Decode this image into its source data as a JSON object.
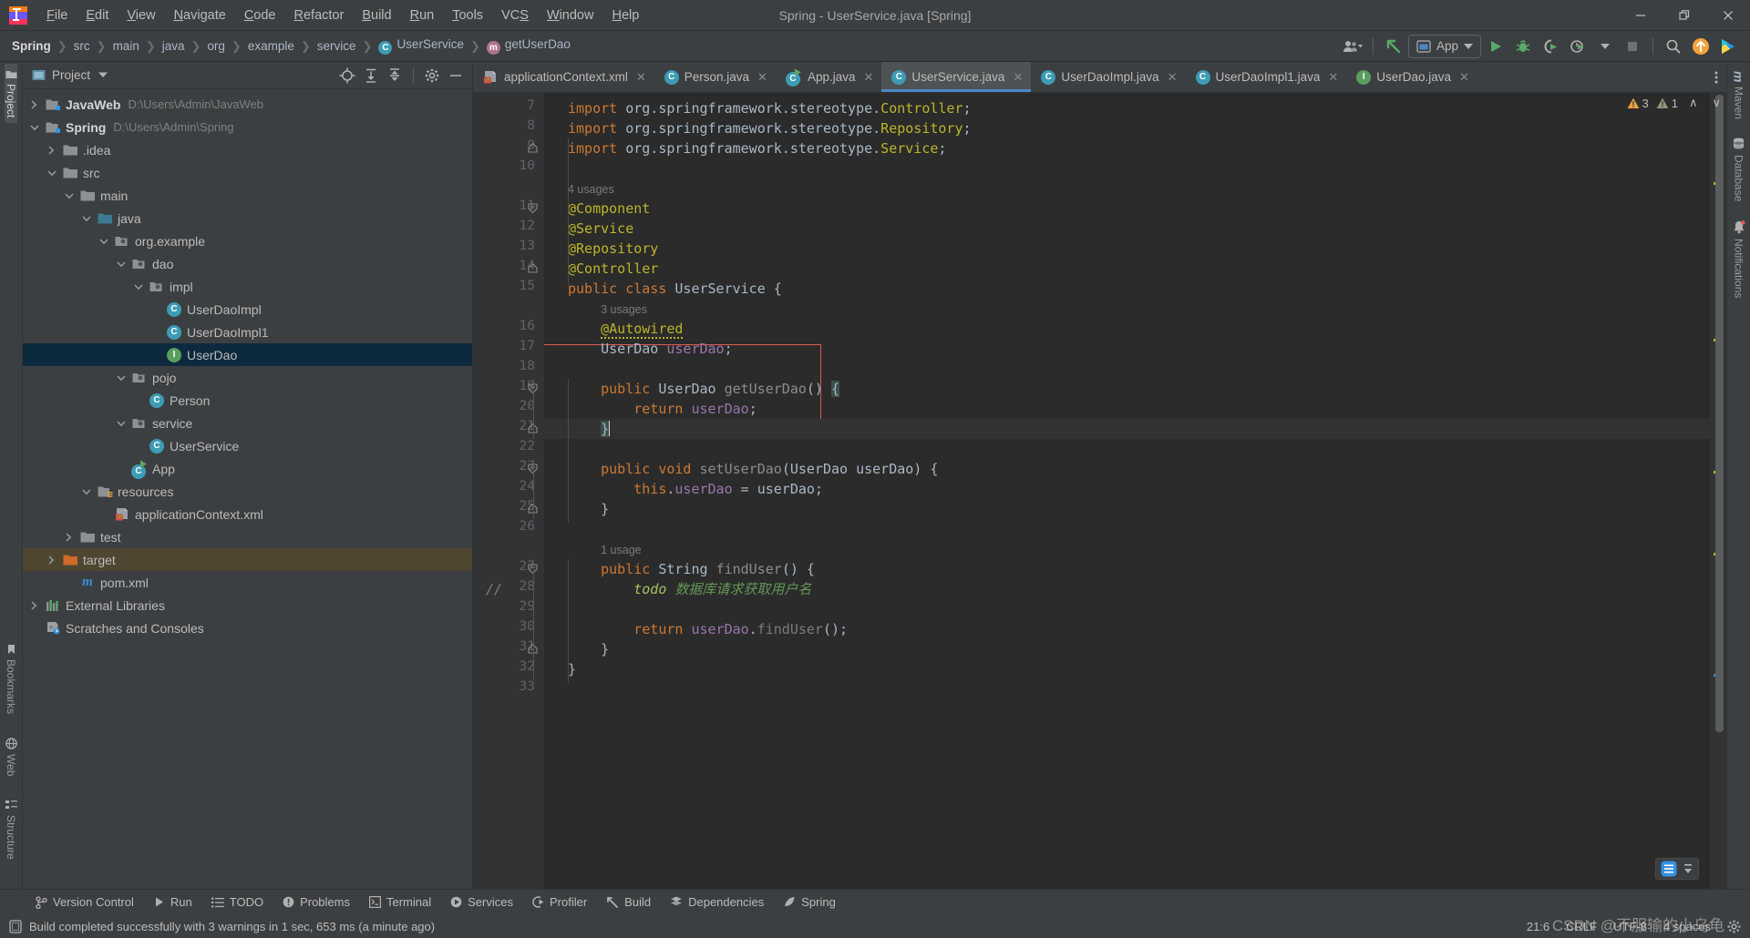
{
  "window": {
    "title": "Spring - UserService.java [Spring]",
    "minimize_label": "—",
    "maximize_label": "❐",
    "close_label": "✕"
  },
  "menubar": {
    "items": [
      {
        "label": "File"
      },
      {
        "label": "Edit"
      },
      {
        "label": "View"
      },
      {
        "label": "Navigate"
      },
      {
        "label": "Code"
      },
      {
        "label": "Refactor"
      },
      {
        "label": "Build"
      },
      {
        "label": "Run"
      },
      {
        "label": "Tools"
      },
      {
        "label": "VCS"
      },
      {
        "label": "Window"
      },
      {
        "label": "Help"
      }
    ]
  },
  "breadcrumbs": [
    {
      "label": "Spring",
      "icon": ""
    },
    {
      "label": "src",
      "icon": ""
    },
    {
      "label": "main",
      "icon": ""
    },
    {
      "label": "java",
      "icon": ""
    },
    {
      "label": "org",
      "icon": ""
    },
    {
      "label": "example",
      "icon": ""
    },
    {
      "label": "service",
      "icon": ""
    },
    {
      "label": "UserService",
      "icon": "class-icon"
    },
    {
      "label": "getUserDao",
      "icon": "method-icon"
    }
  ],
  "toolbar": {
    "run_config": "App",
    "run_config_icon": "app-window-icon",
    "buttons": [
      {
        "name": "profile-dropdown",
        "icon": "user-icon"
      },
      {
        "name": "update-project",
        "icon": "arrow-up-left-icon"
      },
      {
        "name": "run-button",
        "icon": "play-icon"
      },
      {
        "name": "debug-button",
        "icon": "bug-icon"
      },
      {
        "name": "run-with-coverage",
        "icon": "coverage-icon"
      },
      {
        "name": "profiler-button",
        "icon": "clock-play-icon"
      },
      {
        "name": "stop-button",
        "icon": "stop-square-icon"
      },
      {
        "name": "search-everywhere",
        "icon": "search-icon"
      },
      {
        "name": "updates-available",
        "icon": "orange-arrow-icon"
      },
      {
        "name": "ide-assistant",
        "icon": "colorful-icon"
      }
    ]
  },
  "left_strip": {
    "top": [
      {
        "label": "Project",
        "icon": "project-folder-icon",
        "active": true
      }
    ],
    "bottom": [
      {
        "label": "Bookmarks",
        "icon": "bookmark-icon"
      },
      {
        "label": "Web",
        "icon": "web-icon"
      },
      {
        "label": "Structure",
        "icon": "structure-icon"
      }
    ]
  },
  "right_strip": [
    {
      "label": "Maven",
      "icon": "maven-icon"
    },
    {
      "label": "Database",
      "icon": "database-icon"
    },
    {
      "label": "Notifications",
      "icon": "bell-icon",
      "badge": true
    }
  ],
  "project_panel": {
    "title": "Project",
    "actions": [
      {
        "name": "select-opened-file",
        "icon": "target-icon"
      },
      {
        "name": "expand-all",
        "icon": "expand-all-icon"
      },
      {
        "name": "collapse-all",
        "icon": "collapse-all-icon"
      },
      {
        "name": "panel-settings",
        "icon": "gear-icon"
      },
      {
        "name": "hide-panel",
        "icon": "minus-icon"
      }
    ],
    "tree": [
      {
        "label": "JavaWeb",
        "path": "D:\\Users\\Admin\\JavaWeb",
        "depth": 0,
        "twist": "collapsed",
        "icon": "module-folder-icon",
        "bold": true,
        "state": "normal"
      },
      {
        "label": "Spring",
        "path": "D:\\Users\\Admin\\Spring",
        "depth": 0,
        "twist": "expanded",
        "icon": "module-folder-icon",
        "bold": true,
        "state": "normal"
      },
      {
        "label": ".idea",
        "path": "",
        "depth": 1,
        "twist": "collapsed",
        "icon": "folder-icon",
        "bold": false,
        "state": "normal"
      },
      {
        "label": "src",
        "path": "",
        "depth": 1,
        "twist": "expanded",
        "icon": "folder-icon",
        "bold": false,
        "state": "normal"
      },
      {
        "label": "main",
        "path": "",
        "depth": 2,
        "twist": "expanded",
        "icon": "folder-icon",
        "bold": false,
        "state": "normal"
      },
      {
        "label": "java",
        "path": "",
        "depth": 3,
        "twist": "expanded",
        "icon": "source-folder-icon",
        "bold": false,
        "state": "normal"
      },
      {
        "label": "org.example",
        "path": "",
        "depth": 4,
        "twist": "expanded",
        "icon": "package-icon",
        "bold": false,
        "state": "normal"
      },
      {
        "label": "dao",
        "path": "",
        "depth": 5,
        "twist": "expanded",
        "icon": "package-icon",
        "bold": false,
        "state": "normal"
      },
      {
        "label": "impl",
        "path": "",
        "depth": 6,
        "twist": "expanded",
        "icon": "package-icon",
        "bold": false,
        "state": "normal"
      },
      {
        "label": "UserDaoImpl",
        "path": "",
        "depth": 7,
        "twist": "none",
        "icon": "class-icon",
        "bold": false,
        "state": "normal"
      },
      {
        "label": "UserDaoImpl1",
        "path": "",
        "depth": 7,
        "twist": "none",
        "icon": "class-icon",
        "bold": false,
        "state": "normal"
      },
      {
        "label": "UserDao",
        "path": "",
        "depth": 7,
        "twist": "none",
        "icon": "interface-icon",
        "bold": false,
        "state": "selected"
      },
      {
        "label": "pojo",
        "path": "",
        "depth": 5,
        "twist": "expanded",
        "icon": "package-icon",
        "bold": false,
        "state": "normal"
      },
      {
        "label": "Person",
        "path": "",
        "depth": 6,
        "twist": "none",
        "icon": "class-icon",
        "bold": false,
        "state": "normal"
      },
      {
        "label": "service",
        "path": "",
        "depth": 5,
        "twist": "expanded",
        "icon": "package-icon",
        "bold": false,
        "state": "normal"
      },
      {
        "label": "UserService",
        "path": "",
        "depth": 6,
        "twist": "none",
        "icon": "class-icon",
        "bold": false,
        "state": "normal"
      },
      {
        "label": "App",
        "path": "",
        "depth": 5,
        "twist": "none",
        "icon": "runnable-class-icon",
        "bold": false,
        "state": "normal"
      },
      {
        "label": "resources",
        "path": "",
        "depth": 3,
        "twist": "expanded",
        "icon": "resources-folder-icon",
        "bold": false,
        "state": "normal"
      },
      {
        "label": "applicationContext.xml",
        "path": "",
        "depth": 4,
        "twist": "none",
        "icon": "spring-xml-icon",
        "bold": false,
        "state": "normal"
      },
      {
        "label": "test",
        "path": "",
        "depth": 2,
        "twist": "collapsed",
        "icon": "folder-icon",
        "bold": false,
        "state": "normal"
      },
      {
        "label": "target",
        "path": "",
        "depth": 1,
        "twist": "collapsed",
        "icon": "target-folder-icon",
        "bold": false,
        "state": "highlight"
      },
      {
        "label": "pom.xml",
        "path": "",
        "depth": 2,
        "twist": "none",
        "icon": "maven-file-icon",
        "bold": false,
        "state": "normal"
      },
      {
        "label": "External Libraries",
        "path": "",
        "depth": 0,
        "twist": "collapsed",
        "icon": "libraries-icon",
        "bold": false,
        "state": "normal"
      },
      {
        "label": "Scratches and Consoles",
        "path": "",
        "depth": 0,
        "twist": "none",
        "icon": "scratches-icon",
        "bold": false,
        "state": "normal"
      }
    ]
  },
  "editor_tabs": [
    {
      "label": "applicationContext.xml",
      "icon": "spring-xml-icon",
      "active": false
    },
    {
      "label": "Person.java",
      "icon": "class-icon",
      "active": false
    },
    {
      "label": "App.java",
      "icon": "runnable-class-icon",
      "active": false
    },
    {
      "label": "UserService.java",
      "icon": "class-icon",
      "active": true
    },
    {
      "label": "UserDaoImpl.java",
      "icon": "class-icon",
      "active": false
    },
    {
      "label": "UserDaoImpl1.java",
      "icon": "class-icon",
      "active": false
    },
    {
      "label": "UserDao.java",
      "icon": "interface-icon",
      "active": false
    }
  ],
  "inspection": {
    "warnings_count": "3",
    "weak_warnings_count": "1",
    "prev_label": "∧",
    "next_label": "∨"
  },
  "code": {
    "first_line": 7,
    "lines": [
      {
        "num": "7",
        "text": "import org.springframework.stereotype.Controller;"
      },
      {
        "num": "8",
        "text": "import org.springframework.stereotype.Repository;"
      },
      {
        "num": "9",
        "text": "import org.springframework.stereotype.Service;"
      },
      {
        "num": "10",
        "text": ""
      },
      {
        "num": "",
        "text": "4 usages"
      },
      {
        "num": "11",
        "text": "@Component"
      },
      {
        "num": "12",
        "text": "@Service"
      },
      {
        "num": "13",
        "text": "@Repository"
      },
      {
        "num": "14",
        "text": "@Controller"
      },
      {
        "num": "15",
        "text": "public class UserService {"
      },
      {
        "num": "",
        "text": "3 usages"
      },
      {
        "num": "16",
        "text": "@Autowired"
      },
      {
        "num": "17",
        "text": "UserDao userDao;"
      },
      {
        "num": "18",
        "text": ""
      },
      {
        "num": "19",
        "text": "public UserDao getUserDao() {"
      },
      {
        "num": "20",
        "text": "return userDao;"
      },
      {
        "num": "21",
        "text": "}"
      },
      {
        "num": "22",
        "text": ""
      },
      {
        "num": "23",
        "text": "public void setUserDao(UserDao userDao) {"
      },
      {
        "num": "24",
        "text": "this.userDao = userDao;"
      },
      {
        "num": "25",
        "text": "}"
      },
      {
        "num": "26",
        "text": ""
      },
      {
        "num": "",
        "text": "1 usage"
      },
      {
        "num": "27",
        "text": "public String findUser() {"
      },
      {
        "num": "28",
        "text": "todo 数据库请求获取用户名"
      },
      {
        "num": "29",
        "text": ""
      },
      {
        "num": "30",
        "text": "return userDao.findUser();"
      },
      {
        "num": "31",
        "text": "}"
      },
      {
        "num": "32",
        "text": "}"
      },
      {
        "num": "33",
        "text": ""
      }
    ],
    "usage_hint_4": "4 usages",
    "usage_hint_3": "3 usages",
    "usage_hint_1": "1 usage",
    "todo_marker": "//"
  },
  "tool_windows": [
    {
      "label": "Version Control",
      "icon": "branch-icon"
    },
    {
      "label": "Run",
      "icon": "play-icon"
    },
    {
      "label": "TODO",
      "icon": "todo-list-icon"
    },
    {
      "label": "Problems",
      "icon": "problems-icon"
    },
    {
      "label": "Terminal",
      "icon": "terminal-icon"
    },
    {
      "label": "Services",
      "icon": "services-icon"
    },
    {
      "label": "Profiler",
      "icon": "profiler-icon"
    },
    {
      "label": "Build",
      "icon": "build-hammer-icon"
    },
    {
      "label": "Dependencies",
      "icon": "dependencies-icon"
    },
    {
      "label": "Spring",
      "icon": "spring-leaf-icon"
    }
  ],
  "statusbar": {
    "message": "Build completed successfully with 3 warnings in 1 sec, 653 ms (a minute ago)",
    "message_icon": "build-status-icon",
    "caret_position": "21:6",
    "line_separator": "CRLF",
    "encoding": "UTF-8",
    "indent": "4 spaces",
    "watermark": "CSDN @不服输的小乌龟"
  },
  "colors": {
    "accent_blue": "#4a88c7",
    "selection_blue": "#0d293e",
    "highlight_brown": "#4e4631",
    "editor_bg": "#2b2b2b",
    "panel_bg": "#3c3f41",
    "gutter_bg": "#313335",
    "error_red": "#e05a52",
    "warning_yellow": "#e8a33d"
  }
}
